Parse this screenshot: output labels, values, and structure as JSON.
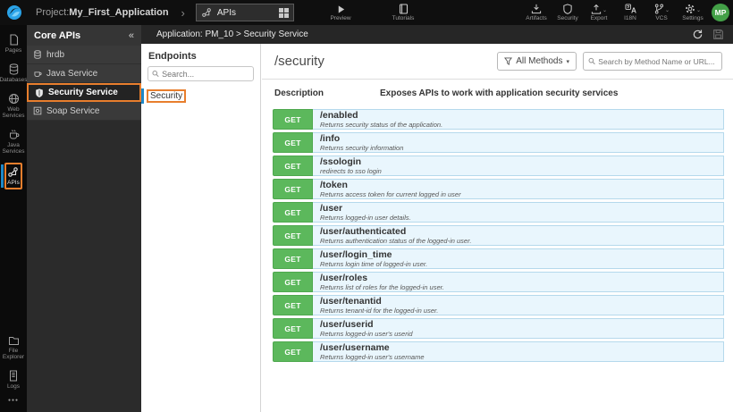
{
  "topbar": {
    "project_label": "Project:",
    "project_name": "My_First_Application",
    "chevron": "›",
    "tab": {
      "label": "APIs"
    },
    "center": [
      {
        "label": "Preview"
      },
      {
        "label": "Tutorials"
      }
    ],
    "right": [
      {
        "label": "Artifacts",
        "caret": false
      },
      {
        "label": "Security",
        "caret": false
      },
      {
        "label": "Export",
        "caret": true
      },
      {
        "label": "I18N",
        "caret": false
      },
      {
        "label": "VCS",
        "caret": true
      },
      {
        "label": "Settings",
        "caret": true
      }
    ],
    "caret_glyph": "⌄",
    "avatar": "MP"
  },
  "rail": {
    "items": [
      {
        "label": "Pages"
      },
      {
        "label": "Databases"
      },
      {
        "label": "Web Services"
      },
      {
        "label": "Java Services"
      },
      {
        "label": "APIs"
      }
    ],
    "bottom_items": [
      {
        "label": "File Explorer"
      },
      {
        "label": "Logs"
      }
    ],
    "more_glyph": "●●●"
  },
  "core_apis": {
    "title": "Core APIs",
    "collapse_glyph": "«",
    "items": [
      {
        "label": "hrdb"
      },
      {
        "label": "Java Service"
      },
      {
        "label": "Security Service"
      },
      {
        "label": "Soap Service"
      }
    ],
    "selected": "Security Service"
  },
  "breadcrumb": "Application: PM_10 > Security Service",
  "endpoints_panel": {
    "title": "Endpoints",
    "search_placeholder": "Search...",
    "items": [
      {
        "label": "Security"
      }
    ]
  },
  "main": {
    "title": "/security",
    "methods_filter_label": "All Methods",
    "methods_caret": "▾",
    "search_placeholder": "Search by Method Name or URL...",
    "description_label": "Description",
    "description_text": "Exposes APIs to work with application security services",
    "endpoints": [
      {
        "method": "GET",
        "path": "/enabled",
        "desc": "Returns security status of the application."
      },
      {
        "method": "GET",
        "path": "/info",
        "desc": "Returns security information"
      },
      {
        "method": "GET",
        "path": "/ssologin",
        "desc": "redirects to sso login"
      },
      {
        "method": "GET",
        "path": "/token",
        "desc": "Returns access token for current logged in user"
      },
      {
        "method": "GET",
        "path": "/user",
        "desc": "Returns logged-in user details."
      },
      {
        "method": "GET",
        "path": "/user/authenticated",
        "desc": "Returns authentication status of the logged-in user."
      },
      {
        "method": "GET",
        "path": "/user/login_time",
        "desc": "Returns login time of logged-in user."
      },
      {
        "method": "GET",
        "path": "/user/roles",
        "desc": "Returns list of roles for the logged-in user."
      },
      {
        "method": "GET",
        "path": "/user/tenantid",
        "desc": "Returns tenant-id for the logged-in user."
      },
      {
        "method": "GET",
        "path": "/user/userid",
        "desc": "Returns logged-in user's userid"
      },
      {
        "method": "GET",
        "path": "/user/username",
        "desc": "Returns logged-in user's username"
      }
    ]
  },
  "colors": {
    "accent_orange": "#e87e2d",
    "accent_blue": "#1e88c7",
    "method_green": "#5cb85c",
    "row_bg": "#e9f6fd",
    "row_border": "#b5d9ec",
    "avatar_green": "#43a047",
    "logo_blue": "#2aa3e8"
  }
}
